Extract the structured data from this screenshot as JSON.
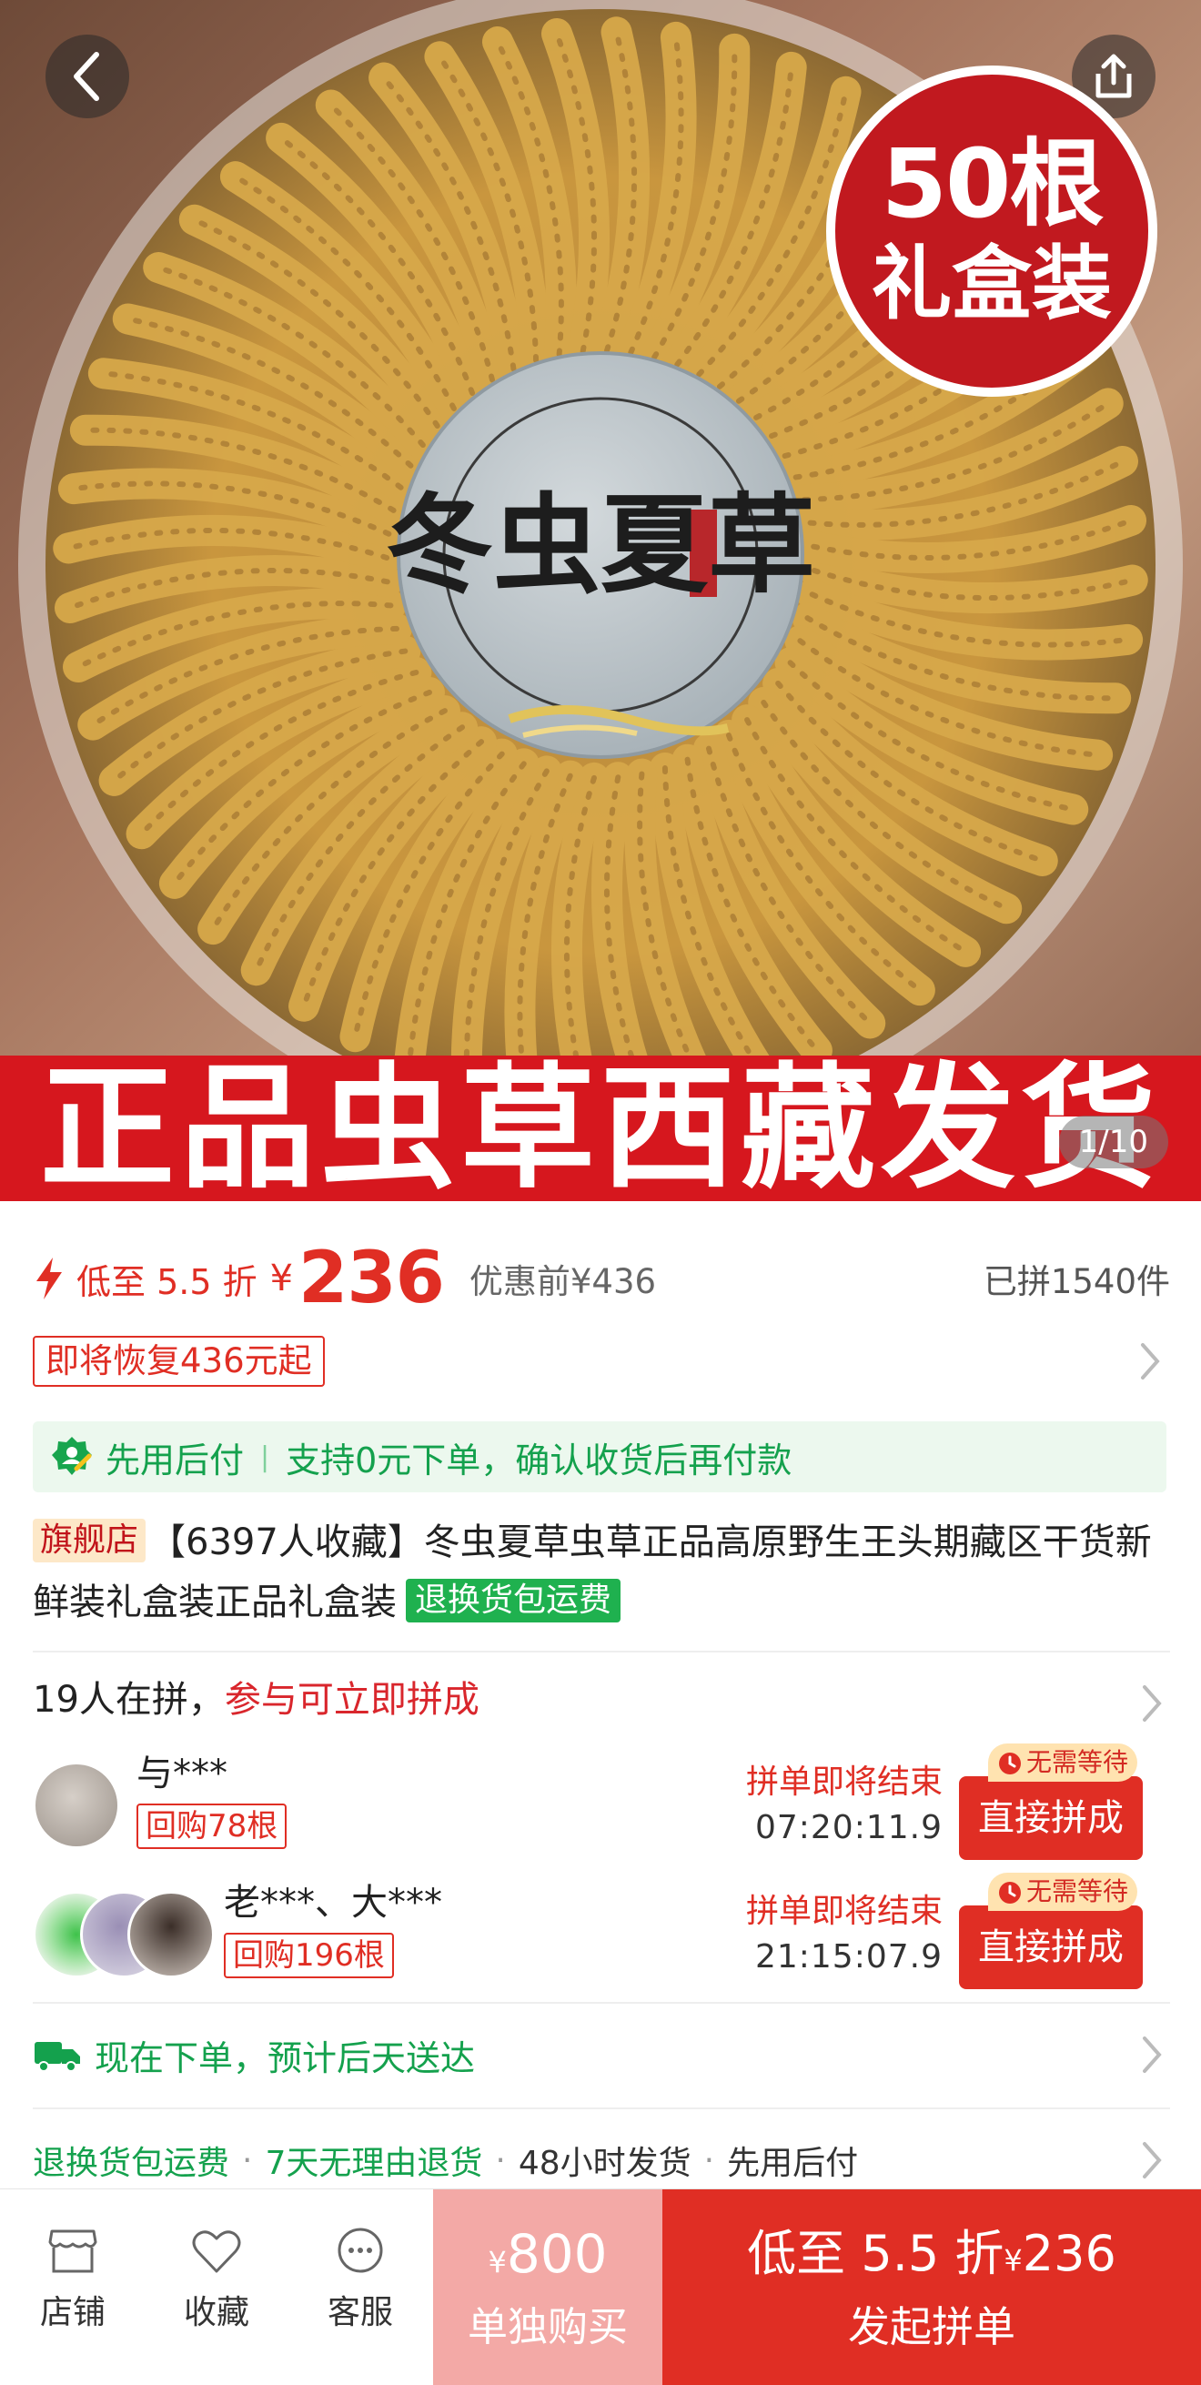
{
  "hero": {
    "badge_line1": "50根",
    "badge_line2": "礼盒装",
    "lid_text": "冬虫夏草",
    "banner_text": "正品虫草西藏发货",
    "pager": "1/10"
  },
  "price": {
    "discount_label": "低至 5.5 折",
    "currency": "¥",
    "amount": "236",
    "original": "优惠前¥436",
    "sold": "已拼1540件",
    "restore_tag": "即将恢复436元起"
  },
  "pay_after": {
    "part1": "先用后付",
    "separator": "|",
    "part2": "支持0元下单，确认收货后再付款"
  },
  "product": {
    "flag_tag": "旗舰店",
    "title": "【6397人收藏】冬虫夏草虫草正品高原野生王头期藏区干货新鲜装礼盒装正品礼盒装",
    "return_tag": "退换货包运费"
  },
  "group_buy": {
    "count_text": "19人在拼，",
    "cta_text": "参与可立即拼成",
    "rows": [
      {
        "name": "与***",
        "rebuy": "回购78根",
        "ending_label": "拼单即将结束",
        "timer": "07:20:11.9",
        "no_wait": "无需等待",
        "button": "直接拼成"
      },
      {
        "name": "老***、大***",
        "rebuy": "回购196根",
        "ending_label": "拼单即将结束",
        "timer": "21:15:07.9",
        "no_wait": "无需等待",
        "button": "直接拼成"
      }
    ]
  },
  "delivery": {
    "text": "现在下单，预计后天送达"
  },
  "services": [
    "退换货包运费",
    "7天无理由退货",
    "48小时发货",
    "先用后付"
  ],
  "service_dot": "·",
  "bottom_bar": {
    "store": "店铺",
    "favorite": "收藏",
    "service": "客服",
    "single_currency": "¥",
    "single_price": "800",
    "single_label": "单独购买",
    "group_prefix": "低至 5.5 折",
    "group_currency": "¥",
    "group_price": "236",
    "group_label": "发起拼单"
  },
  "colors": {
    "accent_red": "#e02e24",
    "banner_red": "#d6171e",
    "green": "#14a14d",
    "single_pink": "#f3a9a6"
  }
}
